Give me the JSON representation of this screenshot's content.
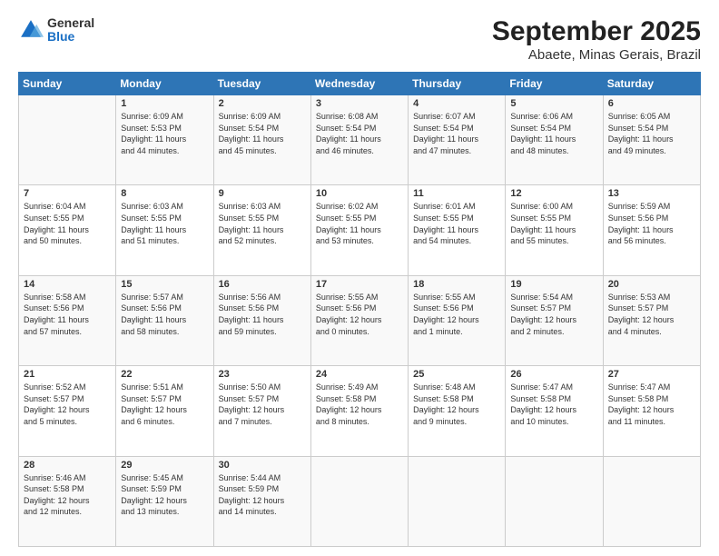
{
  "header": {
    "logo": {
      "general": "General",
      "blue": "Blue"
    },
    "title": "September 2025",
    "subtitle": "Abaete, Minas Gerais, Brazil"
  },
  "calendar": {
    "days": [
      "Sunday",
      "Monday",
      "Tuesday",
      "Wednesday",
      "Thursday",
      "Friday",
      "Saturday"
    ],
    "weeks": [
      [
        {
          "date": "",
          "info": ""
        },
        {
          "date": "1",
          "info": "Sunrise: 6:09 AM\nSunset: 5:53 PM\nDaylight: 11 hours\nand 44 minutes."
        },
        {
          "date": "2",
          "info": "Sunrise: 6:09 AM\nSunset: 5:54 PM\nDaylight: 11 hours\nand 45 minutes."
        },
        {
          "date": "3",
          "info": "Sunrise: 6:08 AM\nSunset: 5:54 PM\nDaylight: 11 hours\nand 46 minutes."
        },
        {
          "date": "4",
          "info": "Sunrise: 6:07 AM\nSunset: 5:54 PM\nDaylight: 11 hours\nand 47 minutes."
        },
        {
          "date": "5",
          "info": "Sunrise: 6:06 AM\nSunset: 5:54 PM\nDaylight: 11 hours\nand 48 minutes."
        },
        {
          "date": "6",
          "info": "Sunrise: 6:05 AM\nSunset: 5:54 PM\nDaylight: 11 hours\nand 49 minutes."
        }
      ],
      [
        {
          "date": "7",
          "info": "Sunrise: 6:04 AM\nSunset: 5:55 PM\nDaylight: 11 hours\nand 50 minutes."
        },
        {
          "date": "8",
          "info": "Sunrise: 6:03 AM\nSunset: 5:55 PM\nDaylight: 11 hours\nand 51 minutes."
        },
        {
          "date": "9",
          "info": "Sunrise: 6:03 AM\nSunset: 5:55 PM\nDaylight: 11 hours\nand 52 minutes."
        },
        {
          "date": "10",
          "info": "Sunrise: 6:02 AM\nSunset: 5:55 PM\nDaylight: 11 hours\nand 53 minutes."
        },
        {
          "date": "11",
          "info": "Sunrise: 6:01 AM\nSunset: 5:55 PM\nDaylight: 11 hours\nand 54 minutes."
        },
        {
          "date": "12",
          "info": "Sunrise: 6:00 AM\nSunset: 5:55 PM\nDaylight: 11 hours\nand 55 minutes."
        },
        {
          "date": "13",
          "info": "Sunrise: 5:59 AM\nSunset: 5:56 PM\nDaylight: 11 hours\nand 56 minutes."
        }
      ],
      [
        {
          "date": "14",
          "info": "Sunrise: 5:58 AM\nSunset: 5:56 PM\nDaylight: 11 hours\nand 57 minutes."
        },
        {
          "date": "15",
          "info": "Sunrise: 5:57 AM\nSunset: 5:56 PM\nDaylight: 11 hours\nand 58 minutes."
        },
        {
          "date": "16",
          "info": "Sunrise: 5:56 AM\nSunset: 5:56 PM\nDaylight: 11 hours\nand 59 minutes."
        },
        {
          "date": "17",
          "info": "Sunrise: 5:55 AM\nSunset: 5:56 PM\nDaylight: 12 hours\nand 0 minutes."
        },
        {
          "date": "18",
          "info": "Sunrise: 5:55 AM\nSunset: 5:56 PM\nDaylight: 12 hours\nand 1 minute."
        },
        {
          "date": "19",
          "info": "Sunrise: 5:54 AM\nSunset: 5:57 PM\nDaylight: 12 hours\nand 2 minutes."
        },
        {
          "date": "20",
          "info": "Sunrise: 5:53 AM\nSunset: 5:57 PM\nDaylight: 12 hours\nand 4 minutes."
        }
      ],
      [
        {
          "date": "21",
          "info": "Sunrise: 5:52 AM\nSunset: 5:57 PM\nDaylight: 12 hours\nand 5 minutes."
        },
        {
          "date": "22",
          "info": "Sunrise: 5:51 AM\nSunset: 5:57 PM\nDaylight: 12 hours\nand 6 minutes."
        },
        {
          "date": "23",
          "info": "Sunrise: 5:50 AM\nSunset: 5:57 PM\nDaylight: 12 hours\nand 7 minutes."
        },
        {
          "date": "24",
          "info": "Sunrise: 5:49 AM\nSunset: 5:58 PM\nDaylight: 12 hours\nand 8 minutes."
        },
        {
          "date": "25",
          "info": "Sunrise: 5:48 AM\nSunset: 5:58 PM\nDaylight: 12 hours\nand 9 minutes."
        },
        {
          "date": "26",
          "info": "Sunrise: 5:47 AM\nSunset: 5:58 PM\nDaylight: 12 hours\nand 10 minutes."
        },
        {
          "date": "27",
          "info": "Sunrise: 5:47 AM\nSunset: 5:58 PM\nDaylight: 12 hours\nand 11 minutes."
        }
      ],
      [
        {
          "date": "28",
          "info": "Sunrise: 5:46 AM\nSunset: 5:58 PM\nDaylight: 12 hours\nand 12 minutes."
        },
        {
          "date": "29",
          "info": "Sunrise: 5:45 AM\nSunset: 5:59 PM\nDaylight: 12 hours\nand 13 minutes."
        },
        {
          "date": "30",
          "info": "Sunrise: 5:44 AM\nSunset: 5:59 PM\nDaylight: 12 hours\nand 14 minutes."
        },
        {
          "date": "",
          "info": ""
        },
        {
          "date": "",
          "info": ""
        },
        {
          "date": "",
          "info": ""
        },
        {
          "date": "",
          "info": ""
        }
      ]
    ]
  }
}
